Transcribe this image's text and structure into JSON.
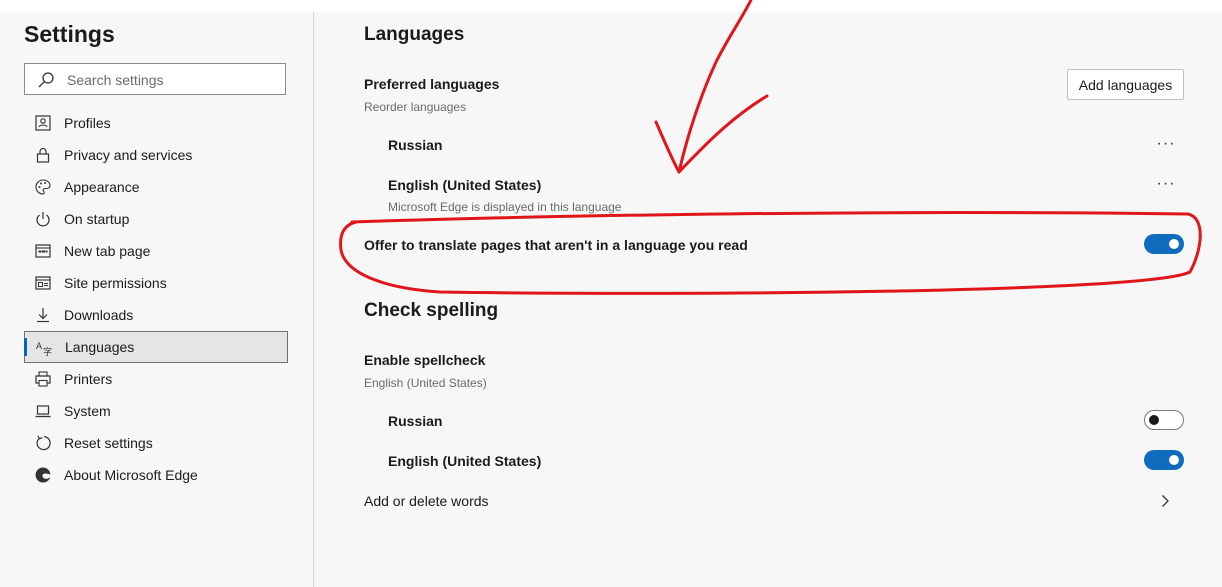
{
  "sidebar": {
    "title": "Settings",
    "search_placeholder": "Search settings",
    "items": [
      {
        "label": "Profiles",
        "icon": "profile-card-icon"
      },
      {
        "label": "Privacy and services",
        "icon": "lock-icon"
      },
      {
        "label": "Appearance",
        "icon": "palette-icon"
      },
      {
        "label": "On startup",
        "icon": "power-icon"
      },
      {
        "label": "New tab page",
        "icon": "new-tab-icon"
      },
      {
        "label": "Site permissions",
        "icon": "site-permissions-icon"
      },
      {
        "label": "Downloads",
        "icon": "download-icon"
      },
      {
        "label": "Languages",
        "icon": "languages-icon",
        "active": true
      },
      {
        "label": "Printers",
        "icon": "printer-icon"
      },
      {
        "label": "System",
        "icon": "laptop-icon"
      },
      {
        "label": "Reset settings",
        "icon": "reset-icon"
      },
      {
        "label": "About Microsoft Edge",
        "icon": "edge-logo-icon"
      }
    ]
  },
  "languages": {
    "title": "Languages",
    "preferred_title": "Preferred languages",
    "preferred_sub": "Reorder languages",
    "add_button": "Add languages",
    "more_glyph": "···",
    "list": [
      {
        "name": "Russian",
        "note": ""
      },
      {
        "name": "English (United States)",
        "note": "Microsoft Edge is displayed in this language"
      }
    ],
    "translate_label": "Offer to translate pages that aren't in a language you read",
    "translate_on": true
  },
  "spelling": {
    "title": "Check spelling",
    "enable_label": "Enable spellcheck",
    "enable_sub": "English (United States)",
    "langs": [
      {
        "name": "Russian",
        "on": false
      },
      {
        "name": "English (United States)",
        "on": true
      }
    ],
    "add_delete_label": "Add or delete words"
  },
  "colors": {
    "accent": "#0f6cbd",
    "annotation": "#e0161b"
  }
}
